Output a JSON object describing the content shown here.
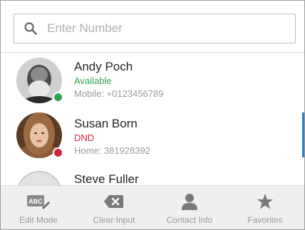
{
  "search": {
    "placeholder": "Enter Number",
    "value": ""
  },
  "contacts": [
    {
      "name": "Andy Poch",
      "status": "Available",
      "status_color": "#2ea44f",
      "detail": "Mobile: +0123456789"
    },
    {
      "name": "Susan Born",
      "status": "DND",
      "status_color": "#d0243a",
      "detail": "Home: 381928392"
    },
    {
      "name": "Steve Fuller"
    }
  ],
  "toolbar": {
    "items": [
      {
        "label": "Edit Mode",
        "icon": "keyboard-abc-icon",
        "icon_text": "ABC"
      },
      {
        "label": "Clear Input",
        "icon": "backspace-icon"
      },
      {
        "label": "Contact Info",
        "icon": "person-icon"
      },
      {
        "label": "Favorites",
        "icon": "star-icon"
      }
    ]
  },
  "colors": {
    "accent": "#2f7bd0",
    "available": "#2ea44f",
    "dnd": "#d0243a",
    "icon_gray": "#7a7a7a"
  }
}
